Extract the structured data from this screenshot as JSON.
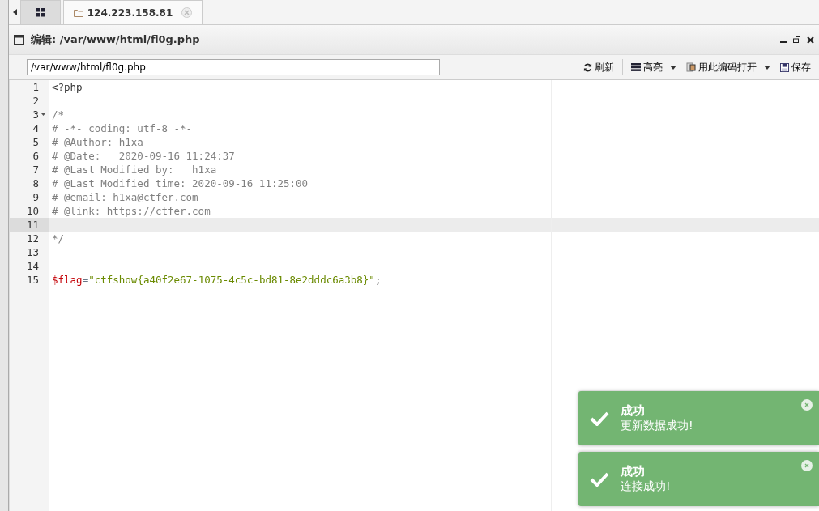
{
  "tabs": [
    {
      "kind": "grid",
      "selected": false
    },
    {
      "kind": "folder",
      "label": "124.223.158.81",
      "selected": true
    }
  ],
  "window": {
    "title": "编辑: /var/www/html/fl0g.php"
  },
  "path_field": {
    "value": "/var/www/html/fl0g.php"
  },
  "toolbar": [
    {
      "kind": "refresh",
      "label": "刷新",
      "dropdown": false
    },
    {
      "kind": "list",
      "label": "高亮",
      "dropdown": true
    },
    {
      "kind": "encoding",
      "label": "用此编码打开",
      "dropdown": true
    },
    {
      "kind": "save",
      "label": "保存",
      "dropdown": false
    }
  ],
  "lines": [
    {
      "number": "1",
      "active": false,
      "fold": false,
      "tokens": [
        {
          "kind": "plain",
          "text": "<?php"
        }
      ]
    },
    {
      "number": "2",
      "active": false,
      "fold": false
    },
    {
      "number": "3",
      "active": false,
      "fold": true,
      "tokens": [
        {
          "kind": "comment",
          "text": "/*"
        }
      ]
    },
    {
      "number": "4",
      "active": false,
      "fold": false,
      "tokens": [
        {
          "kind": "comment",
          "text": "# -*- coding: utf-8 -*-"
        }
      ]
    },
    {
      "number": "5",
      "active": false,
      "fold": false,
      "tokens": [
        {
          "kind": "comment",
          "text": "# @Author: h1xa"
        }
      ]
    },
    {
      "number": "6",
      "active": false,
      "fold": false,
      "tokens": [
        {
          "kind": "comment",
          "text": "# @Date:   2020-09-16 11:24:37"
        }
      ]
    },
    {
      "number": "7",
      "active": false,
      "fold": false,
      "tokens": [
        {
          "kind": "comment",
          "text": "# @Last Modified by:   h1xa"
        }
      ]
    },
    {
      "number": "8",
      "active": false,
      "fold": false,
      "tokens": [
        {
          "kind": "comment",
          "text": "# @Last Modified time: 2020-09-16 11:25:00"
        }
      ]
    },
    {
      "number": "9",
      "active": false,
      "fold": false,
      "tokens": [
        {
          "kind": "comment",
          "text": "# @email: h1xa@ctfer.com"
        }
      ]
    },
    {
      "number": "10",
      "active": false,
      "fold": false,
      "tokens": [
        {
          "kind": "comment",
          "text": "# @link: https://ctfer.com"
        }
      ]
    },
    {
      "number": "11",
      "active": true,
      "fold": false
    },
    {
      "number": "12",
      "active": false,
      "fold": false,
      "tokens": [
        {
          "kind": "comment",
          "text": "*/"
        }
      ]
    },
    {
      "number": "13",
      "active": false,
      "fold": false
    },
    {
      "number": "14",
      "active": false,
      "fold": false
    },
    {
      "number": "15",
      "active": false,
      "fold": false,
      "tokens": [
        {
          "kind": "variable",
          "text": "$flag"
        },
        {
          "kind": "operator",
          "text": "="
        },
        {
          "kind": "string",
          "text": "\"ctfshow{a40f2e67-1075-4c5c-bd81-8e2dddc6a3b8}\""
        },
        {
          "kind": "plain",
          "text": ";"
        }
      ]
    }
  ],
  "toasts": [
    {
      "title": "成功",
      "message": "更新数据成功!"
    },
    {
      "title": "成功",
      "message": "连接成功!"
    }
  ]
}
